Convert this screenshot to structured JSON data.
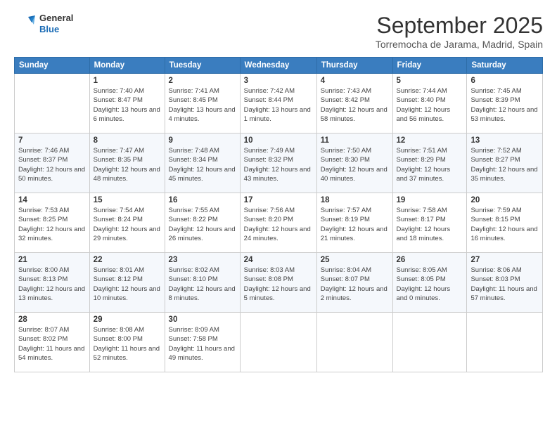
{
  "header": {
    "logo_line1": "General",
    "logo_line2": "Blue",
    "month": "September 2025",
    "location": "Torremocha de Jarama, Madrid, Spain"
  },
  "weekdays": [
    "Sunday",
    "Monday",
    "Tuesday",
    "Wednesday",
    "Thursday",
    "Friday",
    "Saturday"
  ],
  "weeks": [
    [
      {
        "day": "",
        "sunrise": "",
        "sunset": "",
        "daylight": ""
      },
      {
        "day": "1",
        "sunrise": "Sunrise: 7:40 AM",
        "sunset": "Sunset: 8:47 PM",
        "daylight": "Daylight: 13 hours and 6 minutes."
      },
      {
        "day": "2",
        "sunrise": "Sunrise: 7:41 AM",
        "sunset": "Sunset: 8:45 PM",
        "daylight": "Daylight: 13 hours and 4 minutes."
      },
      {
        "day": "3",
        "sunrise": "Sunrise: 7:42 AM",
        "sunset": "Sunset: 8:44 PM",
        "daylight": "Daylight: 13 hours and 1 minute."
      },
      {
        "day": "4",
        "sunrise": "Sunrise: 7:43 AM",
        "sunset": "Sunset: 8:42 PM",
        "daylight": "Daylight: 12 hours and 58 minutes."
      },
      {
        "day": "5",
        "sunrise": "Sunrise: 7:44 AM",
        "sunset": "Sunset: 8:40 PM",
        "daylight": "Daylight: 12 hours and 56 minutes."
      },
      {
        "day": "6",
        "sunrise": "Sunrise: 7:45 AM",
        "sunset": "Sunset: 8:39 PM",
        "daylight": "Daylight: 12 hours and 53 minutes."
      }
    ],
    [
      {
        "day": "7",
        "sunrise": "Sunrise: 7:46 AM",
        "sunset": "Sunset: 8:37 PM",
        "daylight": "Daylight: 12 hours and 50 minutes."
      },
      {
        "day": "8",
        "sunrise": "Sunrise: 7:47 AM",
        "sunset": "Sunset: 8:35 PM",
        "daylight": "Daylight: 12 hours and 48 minutes."
      },
      {
        "day": "9",
        "sunrise": "Sunrise: 7:48 AM",
        "sunset": "Sunset: 8:34 PM",
        "daylight": "Daylight: 12 hours and 45 minutes."
      },
      {
        "day": "10",
        "sunrise": "Sunrise: 7:49 AM",
        "sunset": "Sunset: 8:32 PM",
        "daylight": "Daylight: 12 hours and 43 minutes."
      },
      {
        "day": "11",
        "sunrise": "Sunrise: 7:50 AM",
        "sunset": "Sunset: 8:30 PM",
        "daylight": "Daylight: 12 hours and 40 minutes."
      },
      {
        "day": "12",
        "sunrise": "Sunrise: 7:51 AM",
        "sunset": "Sunset: 8:29 PM",
        "daylight": "Daylight: 12 hours and 37 minutes."
      },
      {
        "day": "13",
        "sunrise": "Sunrise: 7:52 AM",
        "sunset": "Sunset: 8:27 PM",
        "daylight": "Daylight: 12 hours and 35 minutes."
      }
    ],
    [
      {
        "day": "14",
        "sunrise": "Sunrise: 7:53 AM",
        "sunset": "Sunset: 8:25 PM",
        "daylight": "Daylight: 12 hours and 32 minutes."
      },
      {
        "day": "15",
        "sunrise": "Sunrise: 7:54 AM",
        "sunset": "Sunset: 8:24 PM",
        "daylight": "Daylight: 12 hours and 29 minutes."
      },
      {
        "day": "16",
        "sunrise": "Sunrise: 7:55 AM",
        "sunset": "Sunset: 8:22 PM",
        "daylight": "Daylight: 12 hours and 26 minutes."
      },
      {
        "day": "17",
        "sunrise": "Sunrise: 7:56 AM",
        "sunset": "Sunset: 8:20 PM",
        "daylight": "Daylight: 12 hours and 24 minutes."
      },
      {
        "day": "18",
        "sunrise": "Sunrise: 7:57 AM",
        "sunset": "Sunset: 8:19 PM",
        "daylight": "Daylight: 12 hours and 21 minutes."
      },
      {
        "day": "19",
        "sunrise": "Sunrise: 7:58 AM",
        "sunset": "Sunset: 8:17 PM",
        "daylight": "Daylight: 12 hours and 18 minutes."
      },
      {
        "day": "20",
        "sunrise": "Sunrise: 7:59 AM",
        "sunset": "Sunset: 8:15 PM",
        "daylight": "Daylight: 12 hours and 16 minutes."
      }
    ],
    [
      {
        "day": "21",
        "sunrise": "Sunrise: 8:00 AM",
        "sunset": "Sunset: 8:13 PM",
        "daylight": "Daylight: 12 hours and 13 minutes."
      },
      {
        "day": "22",
        "sunrise": "Sunrise: 8:01 AM",
        "sunset": "Sunset: 8:12 PM",
        "daylight": "Daylight: 12 hours and 10 minutes."
      },
      {
        "day": "23",
        "sunrise": "Sunrise: 8:02 AM",
        "sunset": "Sunset: 8:10 PM",
        "daylight": "Daylight: 12 hours and 8 minutes."
      },
      {
        "day": "24",
        "sunrise": "Sunrise: 8:03 AM",
        "sunset": "Sunset: 8:08 PM",
        "daylight": "Daylight: 12 hours and 5 minutes."
      },
      {
        "day": "25",
        "sunrise": "Sunrise: 8:04 AM",
        "sunset": "Sunset: 8:07 PM",
        "daylight": "Daylight: 12 hours and 2 minutes."
      },
      {
        "day": "26",
        "sunrise": "Sunrise: 8:05 AM",
        "sunset": "Sunset: 8:05 PM",
        "daylight": "Daylight: 12 hours and 0 minutes."
      },
      {
        "day": "27",
        "sunrise": "Sunrise: 8:06 AM",
        "sunset": "Sunset: 8:03 PM",
        "daylight": "Daylight: 11 hours and 57 minutes."
      }
    ],
    [
      {
        "day": "28",
        "sunrise": "Sunrise: 8:07 AM",
        "sunset": "Sunset: 8:02 PM",
        "daylight": "Daylight: 11 hours and 54 minutes."
      },
      {
        "day": "29",
        "sunrise": "Sunrise: 8:08 AM",
        "sunset": "Sunset: 8:00 PM",
        "daylight": "Daylight: 11 hours and 52 minutes."
      },
      {
        "day": "30",
        "sunrise": "Sunrise: 8:09 AM",
        "sunset": "Sunset: 7:58 PM",
        "daylight": "Daylight: 11 hours and 49 minutes."
      },
      {
        "day": "",
        "sunrise": "",
        "sunset": "",
        "daylight": ""
      },
      {
        "day": "",
        "sunrise": "",
        "sunset": "",
        "daylight": ""
      },
      {
        "day": "",
        "sunrise": "",
        "sunset": "",
        "daylight": ""
      },
      {
        "day": "",
        "sunrise": "",
        "sunset": "",
        "daylight": ""
      }
    ]
  ]
}
